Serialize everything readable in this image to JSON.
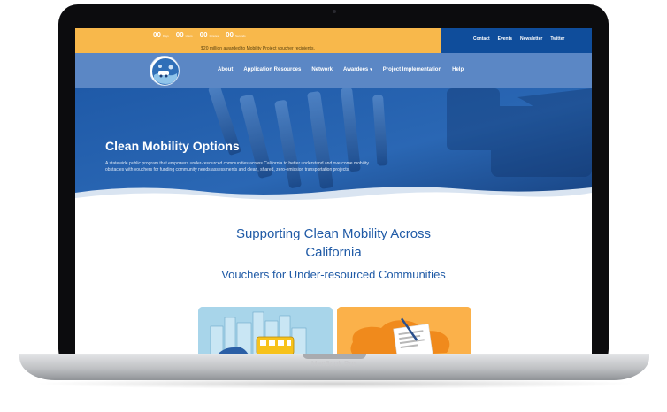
{
  "device": {
    "brand": "MacBook Pro"
  },
  "topbar": {
    "countdown": [
      {
        "number": "00",
        "unit": "Days"
      },
      {
        "number": "00",
        "unit": "Hours"
      },
      {
        "number": "00",
        "unit": "Minutes"
      },
      {
        "number": "00",
        "unit": "Seconds"
      }
    ],
    "announcement": "$20 million awarded to Mobility Project voucher recipients.",
    "links": [
      "Contact",
      "Events",
      "Newsletter",
      "Twitter"
    ]
  },
  "nav": {
    "items": [
      {
        "label": "About"
      },
      {
        "label": "Application Resources"
      },
      {
        "label": "Network"
      },
      {
        "label": "Awardees"
      },
      {
        "label": "Project Implementation"
      },
      {
        "label": "Help"
      }
    ]
  },
  "hero": {
    "title": "Clean Mobility Options",
    "description": "A statewide public program that empowers under-resourced communities across California to better understand and overcome mobility obstacles with vouchers for funding community needs assessments and clean, shared, zero-emission transportation projects."
  },
  "main": {
    "heading_line1": "Supporting Clean Mobility Across",
    "heading_line2": "California",
    "subheading": "Vouchers for Under-resourced Communities"
  },
  "colors": {
    "topbar_orange": "#f8b84b",
    "topbar_navy": "#0f4d9b",
    "nav_blue": "#5b87c5",
    "heading_blue": "#1f5aa6",
    "card_left": "#a8d5ea",
    "card_right": "#fbb14a"
  }
}
